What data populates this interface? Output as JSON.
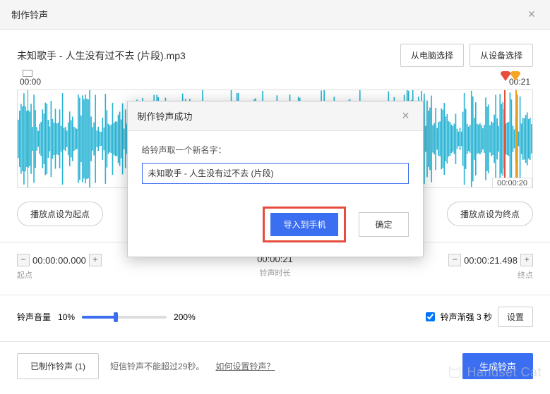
{
  "header": {
    "title": "制作铃声"
  },
  "file": {
    "name": "未知歌手 - 人生没有过不去 (片段).mp3",
    "btn_computer": "从电脑选择",
    "btn_device": "从设备选择"
  },
  "waveform": {
    "time_start": "00:00",
    "time_end": "00:21",
    "duration_badge": "00:00:20"
  },
  "controls": {
    "set_start": "播放点设为起点",
    "set_end": "播放点设为终点"
  },
  "times": {
    "start_value": "00:00:00.000",
    "start_label": "起点",
    "duration_value": "00:00:21",
    "duration_label": "铃声时长",
    "end_value": "00:00:21.498",
    "end_label": "终点"
  },
  "volume": {
    "label": "铃声音量",
    "min": "10%",
    "max": "200%",
    "fade_label": "铃声渐强 3 秒",
    "settings_btn": "设置"
  },
  "bottom": {
    "made_btn": "已制作铃声 (1)",
    "hint": "短信铃声不能超过29秒。",
    "help_link": "如何设置铃声？",
    "generate_btn": "生成铃声"
  },
  "modal": {
    "title": "制作铃声成功",
    "label": "给铃声取一个新名字：",
    "input_value": "未知歌手 - 人生没有过不去 (片段)",
    "import_btn": "导入到手机",
    "confirm_btn": "确定"
  },
  "watermark": "Handset Cat"
}
